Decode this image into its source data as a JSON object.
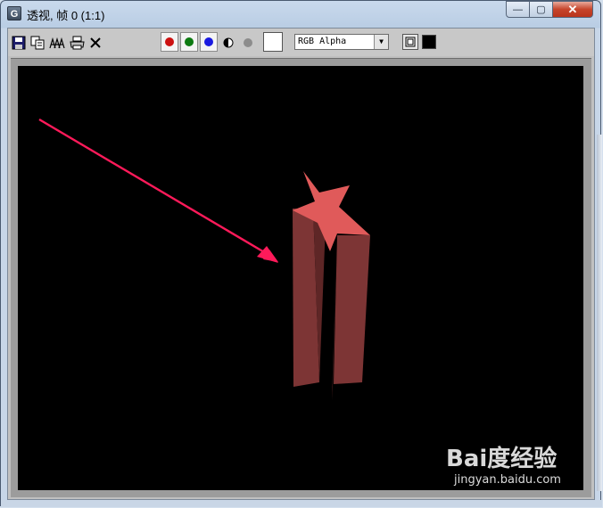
{
  "window": {
    "title": "透视, 帧 0 (1:1)",
    "app_icon_glyph": "G",
    "controls": {
      "minimize": "—",
      "maximize": "▢",
      "close": "✕"
    }
  },
  "toolbar": {
    "save_icon": "save-icon",
    "copy_icon": "copy-icon",
    "clone_icon": "clone-icon",
    "print_icon": "print-icon",
    "clear_icon": "clear-icon",
    "channels": [
      {
        "name": "red-channel",
        "color": "#cc1111"
      },
      {
        "name": "green-channel",
        "color": "#0d7a12"
      },
      {
        "name": "blue-channel",
        "color": "#1a1ae0"
      }
    ],
    "channel_display": "RGB Alpha",
    "swatch_color": "#ffffff"
  },
  "render": {
    "background": "#000000",
    "arrow_color": "#ff1a5a",
    "star_color": "#e05a5a",
    "column_color": "#7d3535",
    "watermark_logo": "Bai度经验",
    "watermark_url": "jingyan.baidu.com"
  }
}
